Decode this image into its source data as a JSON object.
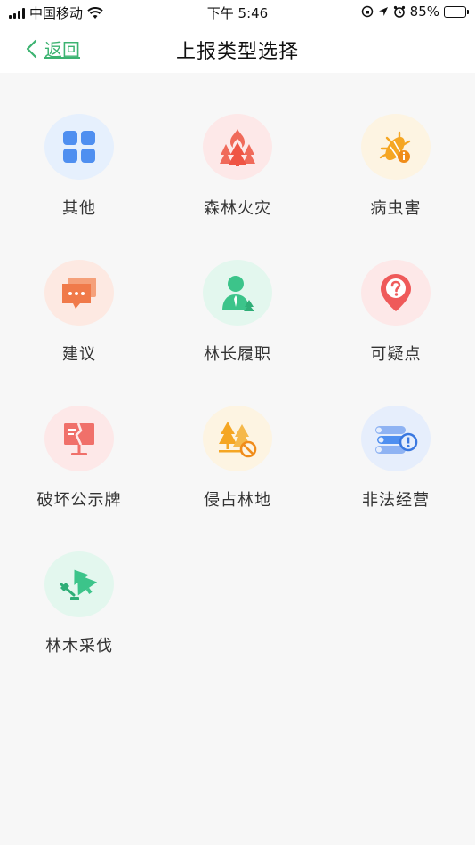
{
  "status_bar": {
    "carrier": "中国移动",
    "time": "下午 5:46",
    "battery": "85%"
  },
  "header": {
    "back_label": "返回",
    "title": "上报类型选择"
  },
  "types": [
    {
      "label": "其他",
      "icon": "app-grid-icon",
      "color": "#4f8ff0"
    },
    {
      "label": "森林火灾",
      "icon": "forest-fire-icon",
      "color": "#f06a5a"
    },
    {
      "label": "病虫害",
      "icon": "pest-icon",
      "color": "#f5a623"
    },
    {
      "label": "建议",
      "icon": "chat-bubble-icon",
      "color": "#f07a4a"
    },
    {
      "label": "林长履职",
      "icon": "ranger-person-icon",
      "color": "#3cc48a"
    },
    {
      "label": "可疑点",
      "icon": "question-pin-icon",
      "color": "#ef5a5a"
    },
    {
      "label": "破坏公示牌",
      "icon": "broken-sign-icon",
      "color": "#f0706a"
    },
    {
      "label": "侵占林地",
      "icon": "forbidden-trees-icon",
      "color": "#f5a623"
    },
    {
      "label": "非法经营",
      "icon": "illegal-timber-icon",
      "color": "#4f8ff0"
    },
    {
      "label": "林木采伐",
      "icon": "tree-felling-icon",
      "color": "#3cc48a"
    }
  ]
}
